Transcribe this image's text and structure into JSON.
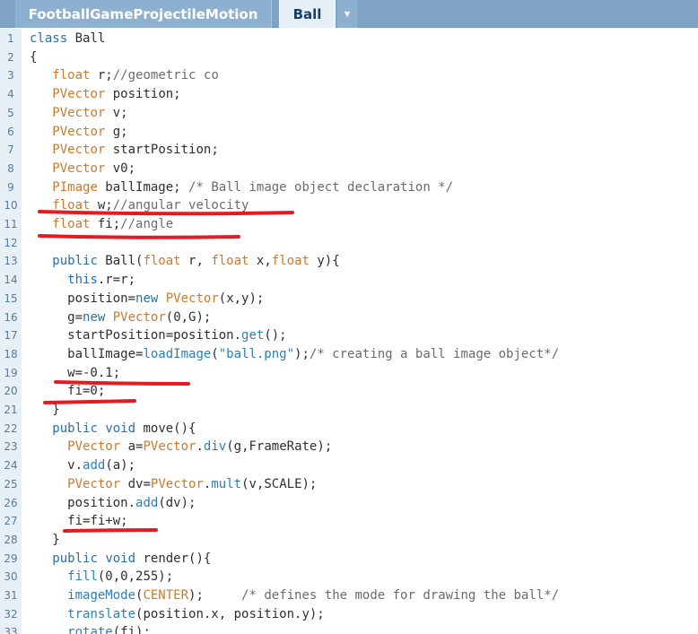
{
  "tabs": {
    "items": [
      {
        "label": "FootballGameProjectileMotion",
        "active": false
      },
      {
        "label": "Ball",
        "active": true
      }
    ],
    "menu_icon": "dropdown-arrow-icon"
  },
  "colors": {
    "tabbar": "#7fa4c6",
    "keyword": "#2a6fa6",
    "type": "#c97a2e",
    "comment": "#6b6b6b",
    "annotation": "#e41b23"
  },
  "editor": {
    "lines": [
      {
        "n": "1",
        "code": "class Ball"
      },
      {
        "n": "2",
        "code": "{"
      },
      {
        "n": "3",
        "code": "   float r;//geometric co"
      },
      {
        "n": "4",
        "code": "   PVector position;"
      },
      {
        "n": "5",
        "code": "   PVector v;"
      },
      {
        "n": "6",
        "code": "   PVector g;"
      },
      {
        "n": "7",
        "code": "   PVector startPosition;"
      },
      {
        "n": "8",
        "code": "   PVector v0;"
      },
      {
        "n": "9",
        "code": "   PImage ballImage; /* Ball image object declaration */"
      },
      {
        "n": "10",
        "code": "   float w;//angular velocity"
      },
      {
        "n": "11",
        "code": "   float fi;//angle"
      },
      {
        "n": "12",
        "code": ""
      },
      {
        "n": "13",
        "code": "   public Ball(float r, float x,float y){"
      },
      {
        "n": "14",
        "code": "     this.r=r;"
      },
      {
        "n": "15",
        "code": "     position=new PVector(x,y);"
      },
      {
        "n": "16",
        "code": "     g=new PVector(0,G);"
      },
      {
        "n": "17",
        "code": "     startPosition=position.get();"
      },
      {
        "n": "18",
        "code": "     ballImage=loadImage(\"ball.png\");/* creating a ball image object*/"
      },
      {
        "n": "19",
        "code": "     w=-0.1;"
      },
      {
        "n": "20",
        "code": "     fi=0;"
      },
      {
        "n": "21",
        "code": "   }"
      },
      {
        "n": "22",
        "code": "   public void move(){"
      },
      {
        "n": "23",
        "code": "     PVector a=PVector.div(g,FrameRate);"
      },
      {
        "n": "24",
        "code": "     v.add(a);"
      },
      {
        "n": "25",
        "code": "     PVector dv=PVector.mult(v,SCALE);"
      },
      {
        "n": "26",
        "code": "     position.add(dv);"
      },
      {
        "n": "27",
        "code": "     fi=fi+w;"
      },
      {
        "n": "28",
        "code": "   }"
      },
      {
        "n": "29",
        "code": "   public void render(){"
      },
      {
        "n": "30",
        "code": "     fill(0,0,255);"
      },
      {
        "n": "31",
        "code": "     imageMode(CENTER);     /* defines the mode for drawing the ball*/"
      },
      {
        "n": "32",
        "code": "     translate(position.x, position.y);"
      },
      {
        "n": "33",
        "code": "     rotate(fi);"
      }
    ]
  }
}
